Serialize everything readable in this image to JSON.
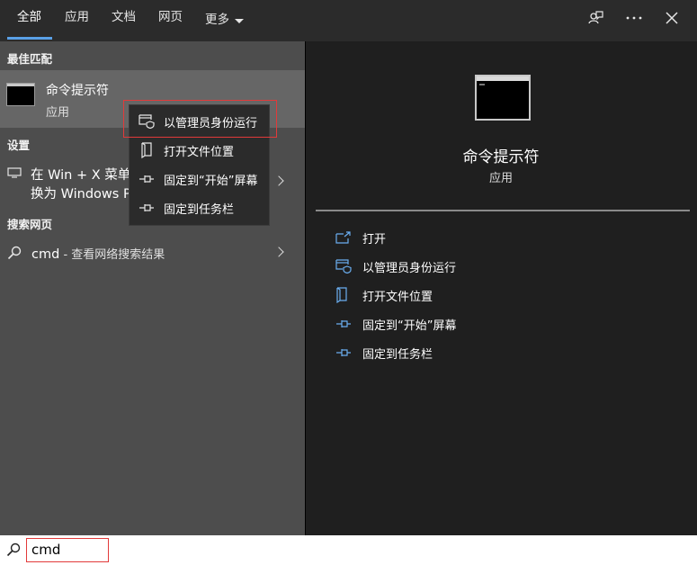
{
  "tabs": [
    {
      "label": "全部"
    },
    {
      "label": "应用"
    },
    {
      "label": "文档"
    },
    {
      "label": "网页"
    },
    {
      "label": "更多"
    }
  ],
  "best_match": {
    "section_label": "最佳匹配",
    "name": "命令提示符",
    "type": "应用"
  },
  "settings": {
    "section_label": "设置",
    "line1": "在 Win + X 菜单",
    "line2": "换为 Windows P"
  },
  "web": {
    "section_label": "搜索网页",
    "query": "cmd",
    "suffix": " - 查看网络搜索结果"
  },
  "context_menu": [
    {
      "label": "以管理员身份运行",
      "icon": "shield-window-icon"
    },
    {
      "label": "打开文件位置",
      "icon": "folder-location-icon"
    },
    {
      "label": "固定到“开始”屏幕",
      "icon": "pin-icon"
    },
    {
      "label": "固定到任务栏",
      "icon": "pin-icon"
    }
  ],
  "preview": {
    "name": "命令提示符",
    "type": "应用",
    "actions": [
      {
        "label": "打开",
        "icon": "open-icon"
      },
      {
        "label": "以管理员身份运行",
        "icon": "shield-window-icon"
      },
      {
        "label": "打开文件位置",
        "icon": "folder-location-icon"
      },
      {
        "label": "固定到“开始”屏幕",
        "icon": "pin-icon"
      },
      {
        "label": "固定到任务栏",
        "icon": "pin-icon"
      }
    ]
  },
  "search": {
    "value": "cmd"
  },
  "colors": {
    "accent": "#5aa0e6",
    "highlight_outline": "#e23a3a"
  }
}
